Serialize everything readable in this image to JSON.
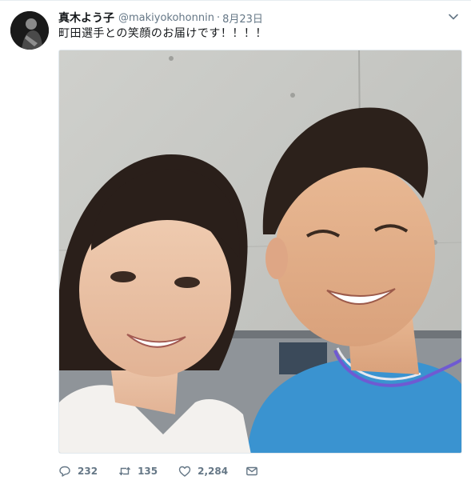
{
  "tweet": {
    "author_name": "真木よう子",
    "author_handle": "@makiyokohonnin",
    "separator": "·",
    "date": "8月23日",
    "text": "町田選手との笑顔のお届けです！！！！",
    "reply_count": "232",
    "retweet_count": "135",
    "like_count": "2,284"
  },
  "icons": {
    "avatar": "avatar-photo",
    "caret": "chevron-down-icon",
    "reply": "reply-icon",
    "retweet": "retweet-icon",
    "like": "heart-icon",
    "dm": "mail-icon"
  },
  "colors": {
    "text": "#14171a",
    "secondary": "#657786",
    "border": "#e1e8ed"
  }
}
